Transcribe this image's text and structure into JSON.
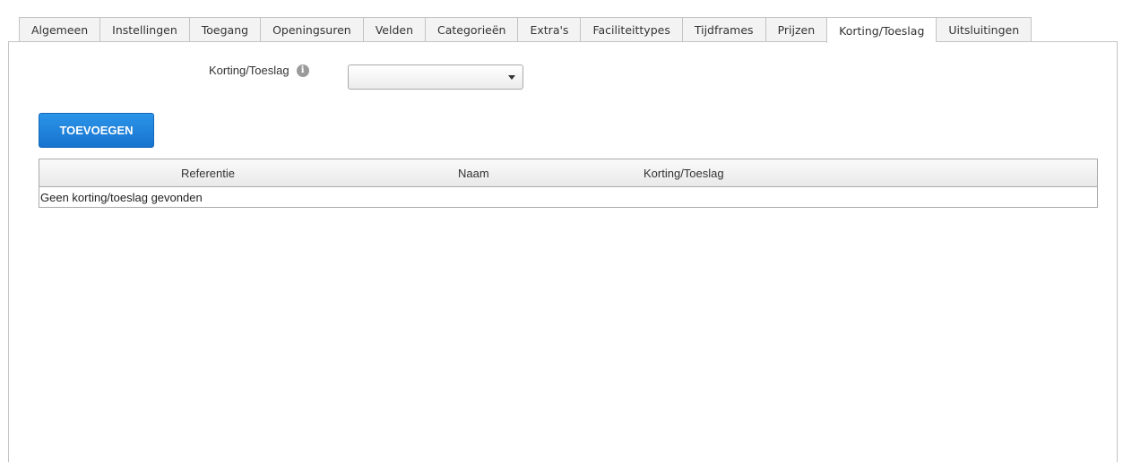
{
  "tabs": [
    {
      "label": "Algemeen",
      "active": false
    },
    {
      "label": "Instellingen",
      "active": false
    },
    {
      "label": "Toegang",
      "active": false
    },
    {
      "label": "Openingsuren",
      "active": false
    },
    {
      "label": "Velden",
      "active": false
    },
    {
      "label": "Categorieën",
      "active": false
    },
    {
      "label": "Extra's",
      "active": false
    },
    {
      "label": "Faciliteittypes",
      "active": false
    },
    {
      "label": "Tijdframes",
      "active": false
    },
    {
      "label": "Prijzen",
      "active": false
    },
    {
      "label": "Korting/Toeslag",
      "active": true
    },
    {
      "label": "Uitsluitingen",
      "active": false
    }
  ],
  "form": {
    "field_label": "Korting/Toeslag",
    "info_icon": "info-icon",
    "select_value": "",
    "caret_icon": "chevron-down-icon"
  },
  "toolbar": {
    "add_label": "TOEVOEGEN"
  },
  "table": {
    "columns": [
      "Referentie",
      "Naam",
      "Korting/Toeslag"
    ],
    "empty_text": "Geen korting/toeslag gevonden"
  },
  "colors": {
    "accent": "#1a7fd9",
    "border": "#c4c4c4"
  }
}
